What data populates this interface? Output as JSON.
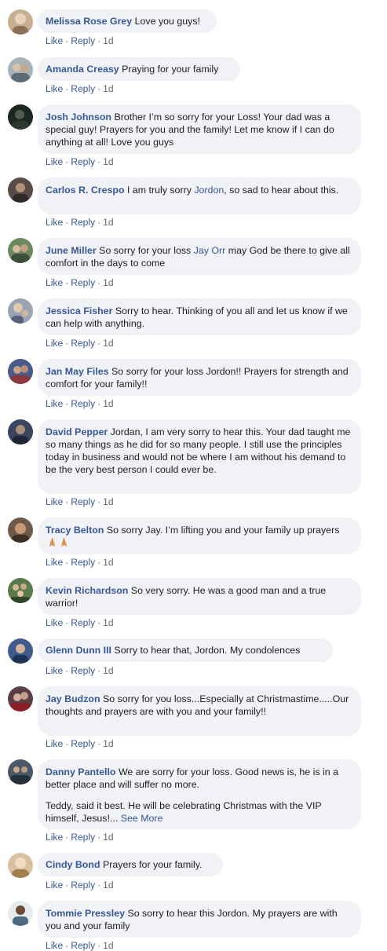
{
  "actions": {
    "like": "Like",
    "reply": "Reply",
    "separator": "·"
  },
  "comments": [
    {
      "author": "Melissa Rose Grey",
      "text": [
        " Love you guys!"
      ],
      "time": "1d",
      "avatar_color": "#c9ad91"
    },
    {
      "author": "Amanda Creasy",
      "text": [
        " Praying for your family"
      ],
      "time": "1d",
      "avatar_color": "#a8b3b8"
    },
    {
      "author": "Josh Johnson",
      "text": [
        " Brother I’m so sorry for your Loss! Your dad was a special guy! Prayers for you and the family! Let me know if I can do anything at all! Love you guys"
      ],
      "time": "1d",
      "avatar_color": "#2c3830"
    },
    {
      "author": "Carlos R. Crespo",
      "text": [
        " I am truly sorry ",
        "Jordon",
        ", so sad to hear about this."
      ],
      "mention_index": 1,
      "time": "1d",
      "avatar_color": "#5a4a48"
    },
    {
      "author": "June Miller",
      "text": [
        " So sorry for your loss ",
        "Jay Orr",
        " may God be there to give all comfort in the days to come"
      ],
      "mention_index": 1,
      "time": "1d",
      "avatar_color": "#6a8a5e"
    },
    {
      "author": "Jessica Fisher",
      "text": [
        " Sorry to hear. Thinking of you all and let us know if we can help with anything."
      ],
      "time": "1d",
      "avatar_color": "#9aa4b4"
    },
    {
      "author": "Jan May Files",
      "text": [
        " So sorry for your loss Jordon!! Prayers for strength and comfort for your family!!"
      ],
      "time": "1d",
      "avatar_color": "#4a5a8a"
    },
    {
      "author": "David Pepper",
      "text": [
        " Jordan, I am very sorry to hear this. Your dad taught me so many things as he did for so many people. I still use the principles today in business and would not be where I am without his demand to be the very best person I could ever be."
      ],
      "time": "1d",
      "avatar_color": "#3a4660"
    },
    {
      "author": "Tracy Belton",
      "text": [
        " So sorry Jay. I’m lifting you and your family up prayers "
      ],
      "emoji": "folded-hands-emoji",
      "time": "1d",
      "avatar_color": "#6e5a48"
    },
    {
      "author": "Kevin Richardson",
      "text": [
        " So very sorry. He was a good man and a true warrior!"
      ],
      "time": "1d",
      "avatar_color": "#5b7a4a"
    },
    {
      "author": "Glenn Dunn III",
      "text": [
        " Sorry to hear that, Jordon. My condolences"
      ],
      "time": "1d",
      "avatar_color": "#3f5a8c"
    },
    {
      "author": "Jay Budzon",
      "text": [
        " So sorry for you loss...Especially at Christmastime.....Our thoughts and prayers are with you and your family!!"
      ],
      "time": "1d",
      "avatar_color": "#5a3e46"
    },
    {
      "author": "Danny Pantello",
      "text": [
        " We are sorry for your loss. Good news is, he is in a better place and will suffer no more."
      ],
      "second_paragraph": "Teddy, said it best. He will be celebrating Christmas with the VIP himself, Jesus!...",
      "see_more": "See More",
      "time": "1d",
      "avatar_color": "#4a5868"
    },
    {
      "author": "Cindy Bond",
      "text": [
        " Prayers for your family."
      ],
      "time": "1d",
      "avatar_color": "#d8c0a0"
    },
    {
      "author": "Tommie Pressley",
      "text": [
        " So sorry to hear this Jordon. My prayers are with you and your family"
      ],
      "time": "1d",
      "avatar_color": "#4e6a7e"
    }
  ]
}
